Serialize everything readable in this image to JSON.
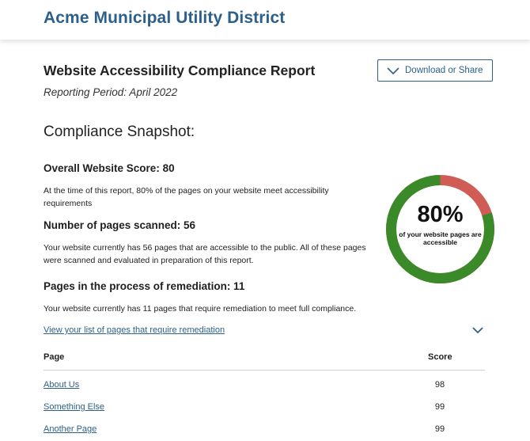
{
  "header": {
    "org_name": "Acme Municipal Utility District"
  },
  "report": {
    "title": "Website Accessibility Compliance Report",
    "period": "Reporting Period: April 2022",
    "download_label": "Download or Share"
  },
  "snapshot": {
    "heading": "Compliance Snapshot:",
    "overall": {
      "heading": "Overall Website Score: 80",
      "text": "At the time of this report, 80% of the pages on your website meet accessibility requirements"
    },
    "scanned": {
      "heading": "Number of pages scanned: 56",
      "text": "Your website currently has 56 pages that are accessible to the public. All of these pages were scanned and evaluated in preparation of this report."
    },
    "remediation": {
      "heading": "Pages in the process of remediation: 11",
      "text": "Your website currently has 11 pages that require remediation to meet full compliance."
    }
  },
  "gauge": {
    "value": 0.8,
    "percent_label": "80%",
    "caption": "of your website pages are accessible",
    "colors": {
      "pass": "#3a8a2a",
      "fail": "#cf5c55"
    }
  },
  "remediation_list": {
    "toggle_label": "View your list of pages that require remediation",
    "columns": {
      "page": "Page",
      "score": "Score"
    },
    "rows": [
      {
        "page": "About Us",
        "score": "98"
      },
      {
        "page": "Something Else",
        "score": "99"
      },
      {
        "page": "Another Page",
        "score": "99"
      }
    ]
  }
}
